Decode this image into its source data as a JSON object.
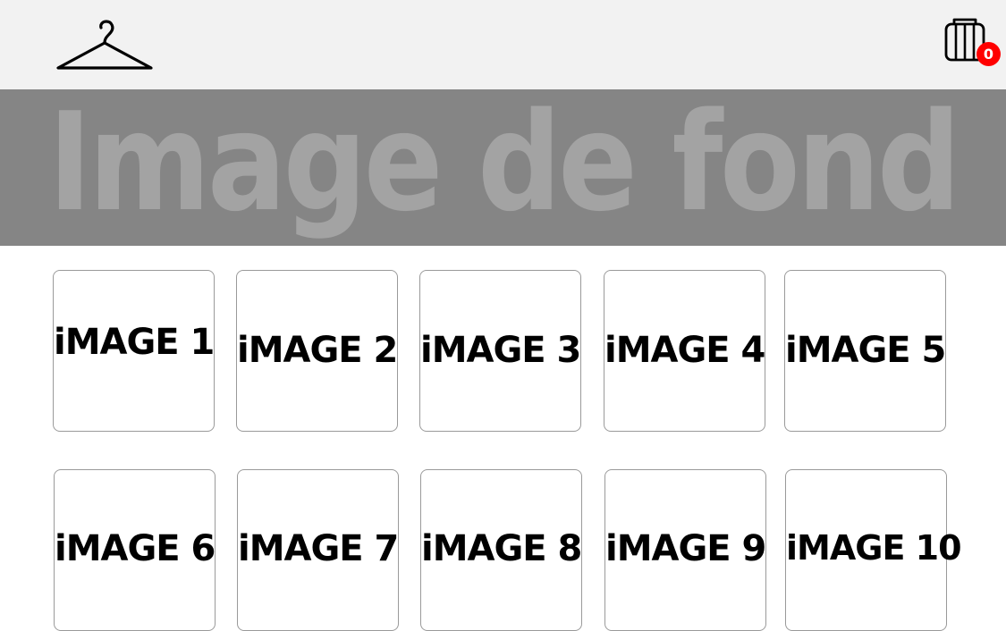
{
  "header": {
    "logo_icon": "hanger-icon",
    "cart_icon": "cart-icon",
    "cart_count": "0",
    "badge_color": "#ff0000"
  },
  "hero": {
    "text": "Image de fond",
    "background_color": "#858585",
    "text_color": "#a3a3a3"
  },
  "products": [
    {
      "label": "iMAGE 1"
    },
    {
      "label": "iMAGE 2"
    },
    {
      "label": "iMAGE 3"
    },
    {
      "label": "iMAGE 4"
    },
    {
      "label": "iMAGE 5"
    },
    {
      "label": "iMAGE 6"
    },
    {
      "label": "iMAGE 7"
    },
    {
      "label": "iMAGE 8"
    },
    {
      "label": "iMAGE 9"
    },
    {
      "label": "iMAGE 10"
    }
  ]
}
